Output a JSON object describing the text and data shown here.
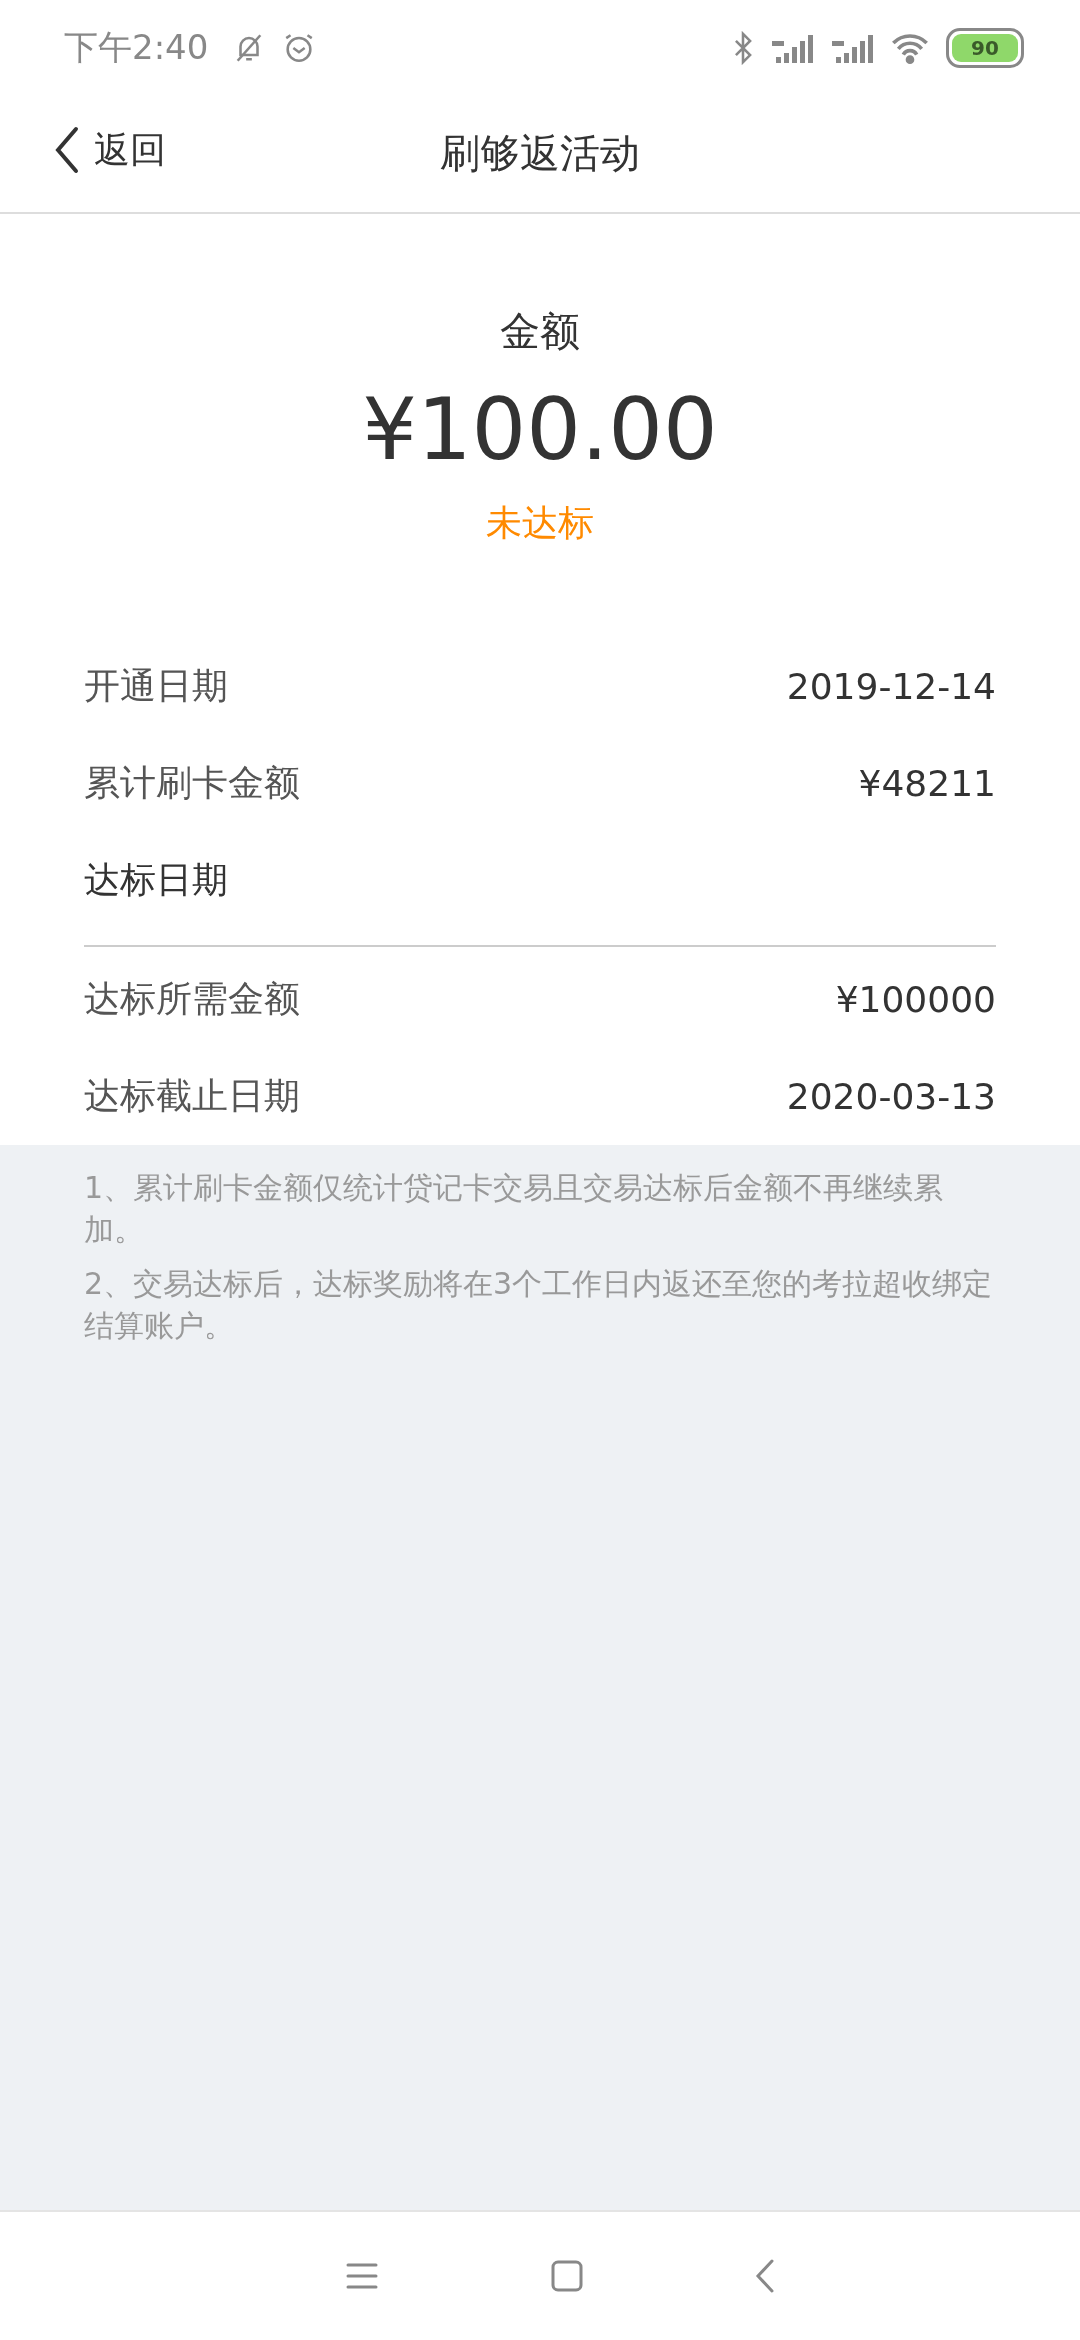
{
  "status_bar": {
    "time": "下午2:40",
    "battery": "90"
  },
  "nav": {
    "back": "返回",
    "title": "刷够返活动"
  },
  "summary": {
    "label": "金额",
    "amount": "¥100.00",
    "status": "未达标"
  },
  "details_top": [
    {
      "label": "开通日期",
      "value": "2019-12-14"
    },
    {
      "label": "累计刷卡金额",
      "value": "¥48211"
    },
    {
      "label": "达标日期"
    }
  ],
  "details_bottom": [
    {
      "label": "达标所需金额",
      "value": "¥100000"
    },
    {
      "label": "达标截止日期",
      "value": "2020-03-13"
    }
  ],
  "notes": [
    "1、累计刷卡金额仅统计贷记卡交易且交易达标后金额不再继续累加。",
    "2、交易达标后，达标奖励将在3个工作日内返还至您的考拉超收绑定结算账户。"
  ]
}
